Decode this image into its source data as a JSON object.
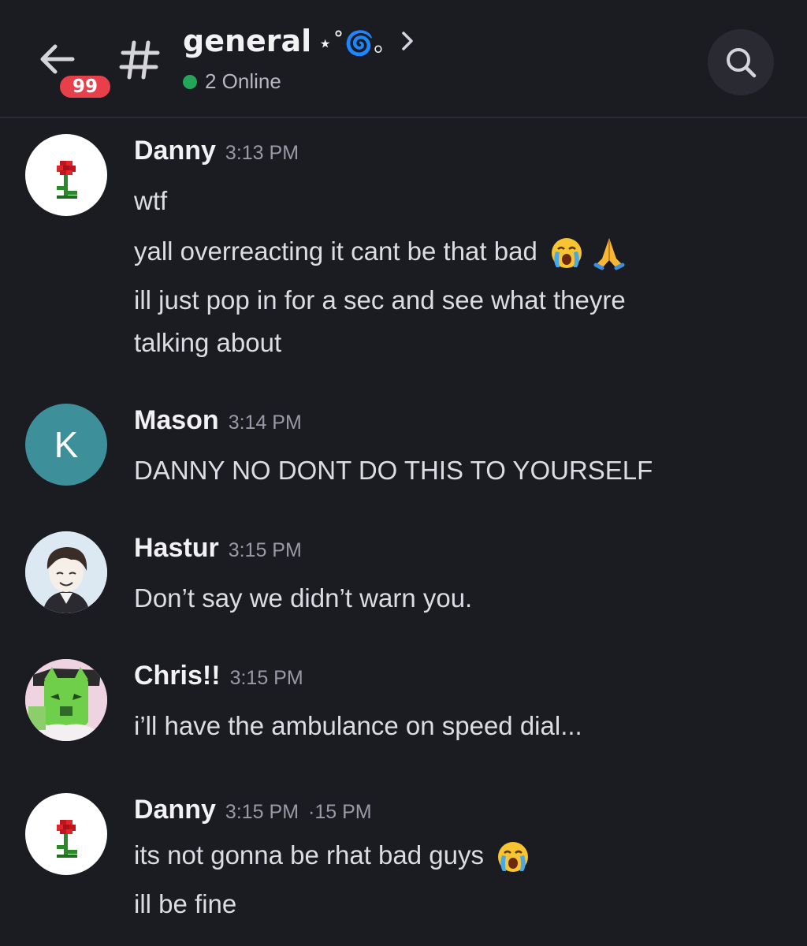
{
  "header": {
    "unread_count": "99",
    "channel_name": "general",
    "channel_decoration": "⋆˚🌀｡",
    "online_text": "2 Online",
    "online_color": "#23a55a",
    "badge_color": "#e8404a"
  },
  "messages": [
    {
      "author": "Danny",
      "time": "3:13 PM",
      "avatar": "rose-pixel-avatar",
      "lines": [
        "wtf",
        "yall overreacting it cant be that bad",
        "ill just pop in for a sec and see what theyre",
        "talking about"
      ],
      "emojis": [
        "loudly-crying-face-emoji",
        "folded-hands-emoji"
      ]
    },
    {
      "author": "Mason",
      "time": "3:14 PM",
      "avatar_letter": "K",
      "lines": [
        "DANNY NO DONT DO THIS TO YOURSELF"
      ]
    },
    {
      "author": "Hastur",
      "time": "3:15 PM",
      "avatar": "anime-boy-avatar",
      "lines": [
        "Don’t say we didn’t warn you."
      ]
    },
    {
      "author": "Chris!!",
      "time": "3:15 PM",
      "avatar": "green-cat-avatar",
      "lines": [
        "i’ll have the ambulance on speed dial..."
      ]
    },
    {
      "author": "Danny",
      "time": "3:15 PM",
      "time_ghost": "·15 PM",
      "avatar": "rose-pixel-avatar",
      "lines": [
        "its not gonna be rhat bad guys",
        "ill be fine"
      ],
      "emojis": [
        "loudly-crying-face-emoji"
      ]
    }
  ]
}
